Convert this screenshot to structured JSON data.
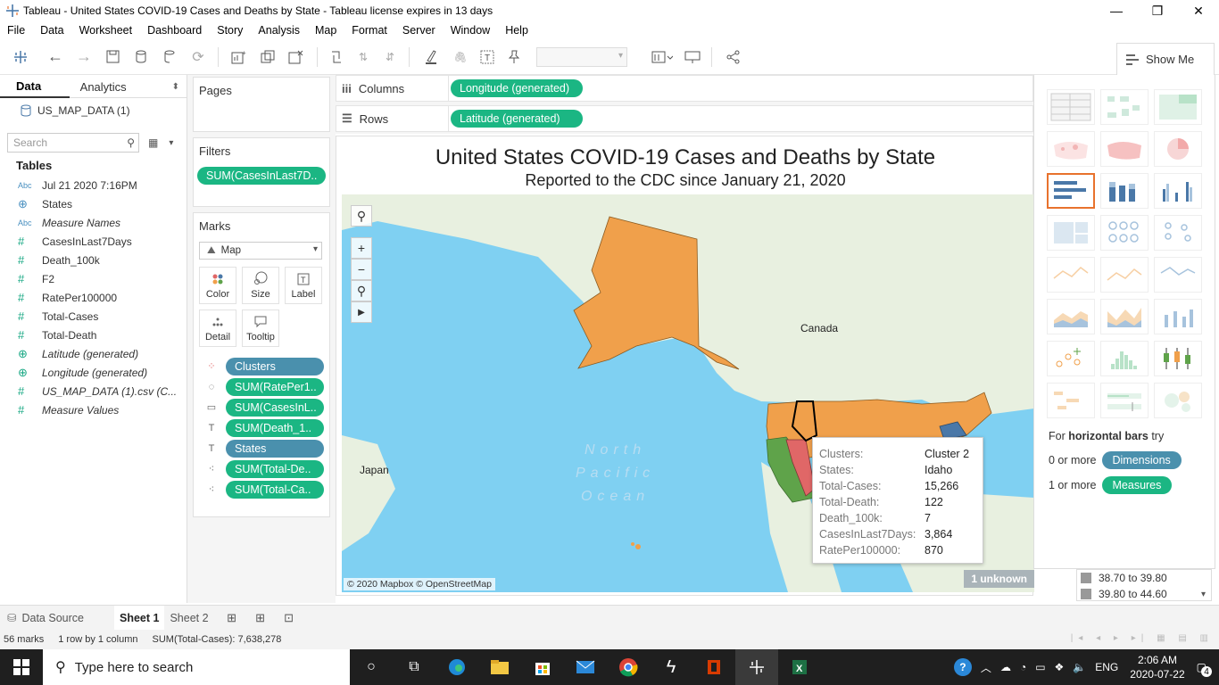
{
  "window": {
    "title": "Tableau - United States COVID-19 Cases and Deaths by State - Tableau license expires in 13 days"
  },
  "menu": [
    "File",
    "Data",
    "Worksheet",
    "Dashboard",
    "Story",
    "Analysis",
    "Map",
    "Format",
    "Server",
    "Window",
    "Help"
  ],
  "toolbar": {
    "show_me_label": "Show Me"
  },
  "data_pane": {
    "tab_data": "Data",
    "tab_analytics": "Analytics",
    "datasource": "US_MAP_DATA (1)",
    "search_placeholder": "Search",
    "tables_heading": "Tables",
    "fields": [
      {
        "type": "Abc",
        "name": "Jul 21 2020  7:16PM"
      },
      {
        "type": "⊕",
        "name": "States"
      },
      {
        "type": "Abc",
        "name": "Measure Names"
      },
      {
        "type": "#",
        "name": "CasesInLast7Days"
      },
      {
        "type": "#",
        "name": "Death_100k"
      },
      {
        "type": "#",
        "name": "F2"
      },
      {
        "type": "#",
        "name": "RatePer100000"
      },
      {
        "type": "#",
        "name": "Total-Cases"
      },
      {
        "type": "#",
        "name": "Total-Death"
      },
      {
        "type": "⊕",
        "name": "Latitude (generated)"
      },
      {
        "type": "⊕",
        "name": "Longitude (generated)"
      },
      {
        "type": "#",
        "name": "US_MAP_DATA (1).csv (C..."
      },
      {
        "type": "#",
        "name": "Measure Values"
      }
    ]
  },
  "pages": {
    "title": "Pages"
  },
  "filters": {
    "title": "Filters",
    "pill": "SUM(CasesInLast7D.."
  },
  "marks": {
    "title": "Marks",
    "type": "Map",
    "buttons": [
      "Color",
      "Size",
      "Label",
      "Detail",
      "Tooltip"
    ],
    "items": [
      {
        "icon": "color",
        "label": "Clusters",
        "kind": "dim"
      },
      {
        "icon": "size",
        "label": "SUM(RatePer1..",
        "kind": "meas"
      },
      {
        "icon": "tooltip",
        "label": "SUM(CasesInL..",
        "kind": "meas"
      },
      {
        "icon": "label",
        "label": "SUM(Death_1..",
        "kind": "meas"
      },
      {
        "icon": "label",
        "label": "States",
        "kind": "dim"
      },
      {
        "icon": "detail",
        "label": "SUM(Total-De..",
        "kind": "meas"
      },
      {
        "icon": "detail",
        "label": "SUM(Total-Ca..",
        "kind": "meas"
      }
    ]
  },
  "shelves": {
    "columns_label": "Columns",
    "columns_pill": "Longitude (generated)",
    "rows_label": "Rows",
    "rows_pill": "Latitude (generated)"
  },
  "viz": {
    "title": "United States COVID-19 Cases and Deaths by State",
    "subtitle": "Reported to the CDC since January 21, 2020",
    "labels": {
      "canada": "Canada",
      "japan": "Japan",
      "ocean": "North\nPacific\nOcean"
    },
    "attribution": "© 2020 Mapbox © OpenStreetMap",
    "unknown": "1 unknown"
  },
  "tooltip": [
    {
      "k": "Clusters:",
      "v": "Cluster 2"
    },
    {
      "k": "States:",
      "v": "Idaho"
    },
    {
      "k": "Total-Cases:",
      "v": "15,266"
    },
    {
      "k": "Total-Death:",
      "v": "122"
    },
    {
      "k": "Death_100k:",
      "v": "7"
    },
    {
      "k": "CasesInLast7Days:",
      "v": "3,864"
    },
    {
      "k": "RatePer100000:",
      "v": "870"
    }
  ],
  "show_me": {
    "hint_prefix": "For",
    "hint_bold": "horizontal bars",
    "hint_suffix": "try",
    "req1_text": "0 or more",
    "req1_pill": "Dimensions",
    "req2_text": "1 or more",
    "req2_pill": "Measures"
  },
  "legend": [
    "38.70 to 39.80",
    "39.80 to 44.60"
  ],
  "sheets": {
    "data_source": "Data Source",
    "tabs": [
      "Sheet 1",
      "Sheet 2"
    ]
  },
  "status": {
    "marks": "56 marks",
    "rows": "1 row by 1 column",
    "sum": "SUM(Total-Cases): 7,638,278"
  },
  "taskbar": {
    "search": "Type here to search",
    "lang": "ENG",
    "time": "2:06 AM",
    "date": "2020-07-22",
    "notifications": "4"
  },
  "colors": {
    "accent_green": "#1bb683",
    "dim_blue": "#4a90ad",
    "orange_state": "#f0a04b",
    "red_state": "#e06767",
    "green_state": "#5fa34a",
    "ocean": "#7fd0f2",
    "land": "#e8f0e0"
  }
}
